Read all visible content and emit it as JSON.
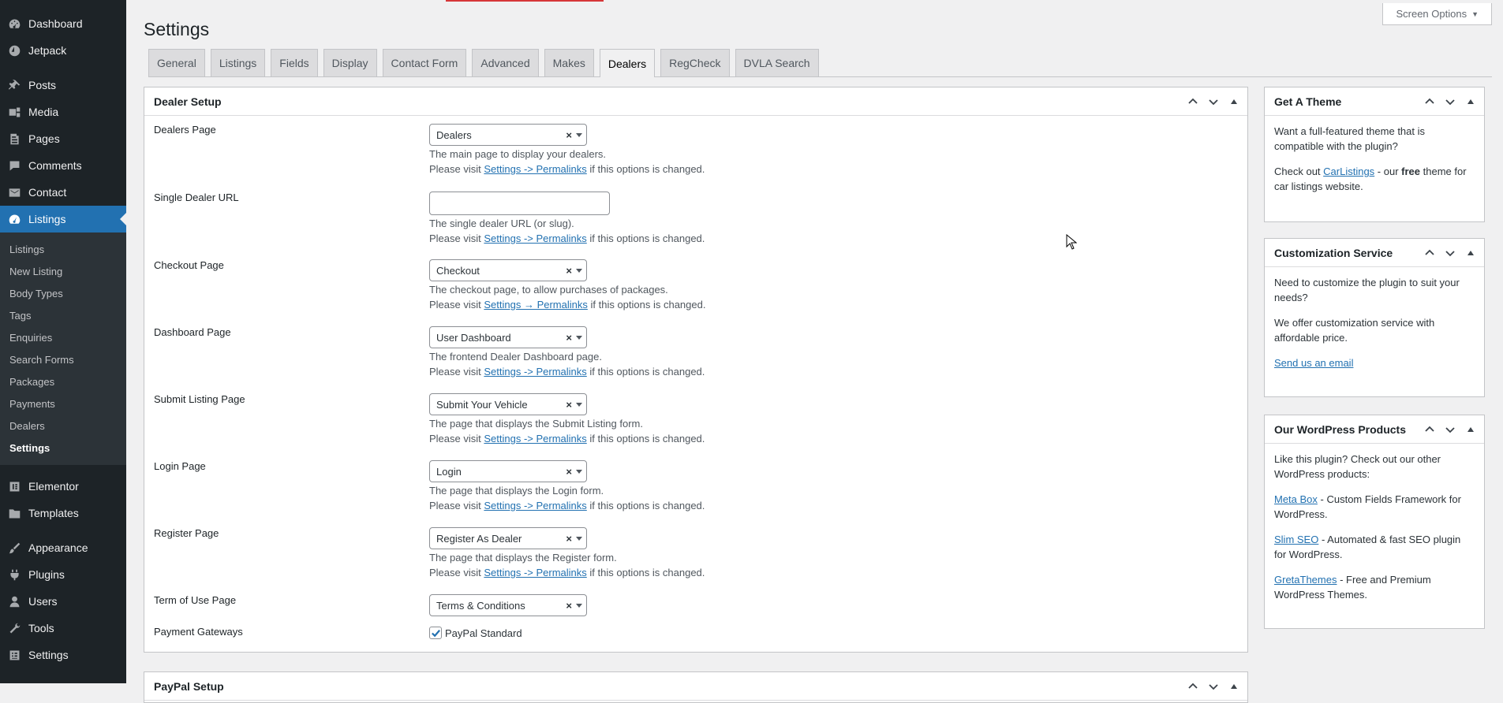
{
  "sidebar": {
    "top_items": [
      {
        "label": "Dashboard",
        "icon": "dashboard-icon"
      },
      {
        "label": "Jetpack",
        "icon": "jetpack-icon"
      },
      {
        "label": "Posts",
        "icon": "pin-icon"
      },
      {
        "label": "Media",
        "icon": "media-icon"
      },
      {
        "label": "Pages",
        "icon": "pages-icon"
      },
      {
        "label": "Comments",
        "icon": "comments-icon"
      },
      {
        "label": "Contact",
        "icon": "email-icon"
      },
      {
        "label": "Listings",
        "icon": "gauge-icon"
      }
    ],
    "submenu": [
      "Listings",
      "New Listing",
      "Body Types",
      "Tags",
      "Enquiries",
      "Search Forms",
      "Packages",
      "Payments",
      "Dealers",
      "Settings"
    ],
    "bottom_items": [
      {
        "label": "Elementor",
        "icon": "elementor-icon"
      },
      {
        "label": "Templates",
        "icon": "folder-icon"
      },
      {
        "label": "Appearance",
        "icon": "brush-icon"
      },
      {
        "label": "Plugins",
        "icon": "plugin-icon"
      },
      {
        "label": "Users",
        "icon": "user-icon"
      },
      {
        "label": "Tools",
        "icon": "wrench-icon"
      },
      {
        "label": "Settings",
        "icon": "settings-icon"
      }
    ]
  },
  "header": {
    "title": "Settings",
    "screen_options": "Screen Options"
  },
  "tabs": [
    "General",
    "Listings",
    "Fields",
    "Display",
    "Contact Form",
    "Advanced",
    "Makes",
    "Dealers",
    "RegCheck",
    "DVLA Search"
  ],
  "active_tab": "Dealers",
  "dealer_setup": {
    "title": "Dealer Setup",
    "fields": {
      "dealers_page": {
        "label": "Dealers Page",
        "value": "Dealers",
        "desc1": "The main page to display your dealers.",
        "pre": "Please visit ",
        "link": "Settings -> Permalinks",
        "post": " if this options is changed."
      },
      "single_dealer_url": {
        "label": "Single Dealer URL",
        "value": "",
        "desc1": "The single dealer URL (or slug).",
        "pre": "Please visit ",
        "link": "Settings -> Permalinks",
        "post": " if this options is changed."
      },
      "checkout_page": {
        "label": "Checkout Page",
        "value": "Checkout",
        "desc1": "The checkout page, to allow purchases of packages.",
        "pre": "Please visit ",
        "link": "Settings → Permalinks",
        "post": " if this options is changed."
      },
      "dashboard_page": {
        "label": "Dashboard Page",
        "value": "User Dashboard",
        "desc1": "The frontend Dealer Dashboard page.",
        "pre": "Please visit ",
        "link": "Settings -> Permalinks",
        "post": " if this options is changed."
      },
      "submit_listing_page": {
        "label": "Submit Listing Page",
        "value": "Submit Your Vehicle",
        "desc1": "The page that displays the Submit Listing form.",
        "pre": "Please visit ",
        "link": "Settings -> Permalinks",
        "post": " if this options is changed."
      },
      "login_page": {
        "label": "Login Page",
        "value": "Login",
        "desc1": "The page that displays the Login form.",
        "pre": "Please visit ",
        "link": "Settings -> Permalinks",
        "post": " if this options is changed."
      },
      "register_page": {
        "label": "Register Page",
        "value": "Register As Dealer",
        "desc1": "The page that displays the Register form.",
        "pre": "Please visit ",
        "link": "Settings -> Permalinks",
        "post": " if this options is changed."
      },
      "term_of_use_page": {
        "label": "Term of Use Page",
        "value": "Terms & Conditions"
      },
      "payment_gateways": {
        "label": "Payment Gateways",
        "option": "PayPal Standard",
        "checked": true
      }
    },
    "clear_glyph": "×"
  },
  "paypal_setup": {
    "title": "PayPal Setup"
  },
  "get_theme": {
    "title": "Get A Theme",
    "p1": "Want a full-featured theme that is compatible with the plugin?",
    "p2_pre": "Check out ",
    "p2_link": "CarListings",
    "p2_mid": " - our ",
    "p2_bold": "free",
    "p2_post": " theme for car listings website."
  },
  "customization": {
    "title": "Customization Service",
    "p1": "Need to customize the plugin to suit your needs?",
    "p2": "We offer customization service with affordable price.",
    "link": "Send us an email"
  },
  "wp_products": {
    "title": "Our WordPress Products",
    "intro": "Like this plugin? Check out our other WordPress products:",
    "items": [
      {
        "link": "Meta Box",
        "text": " - Custom Fields Framework for WordPress."
      },
      {
        "link": "Slim SEO",
        "text": " - Automated & fast SEO plugin for WordPress."
      },
      {
        "link": "GretaThemes",
        "text": " - Free and Premium WordPress Themes."
      }
    ]
  },
  "colors": {
    "sidebar_bg": "#1d2327",
    "accent": "#2271b1",
    "background": "#f0f0f1"
  }
}
